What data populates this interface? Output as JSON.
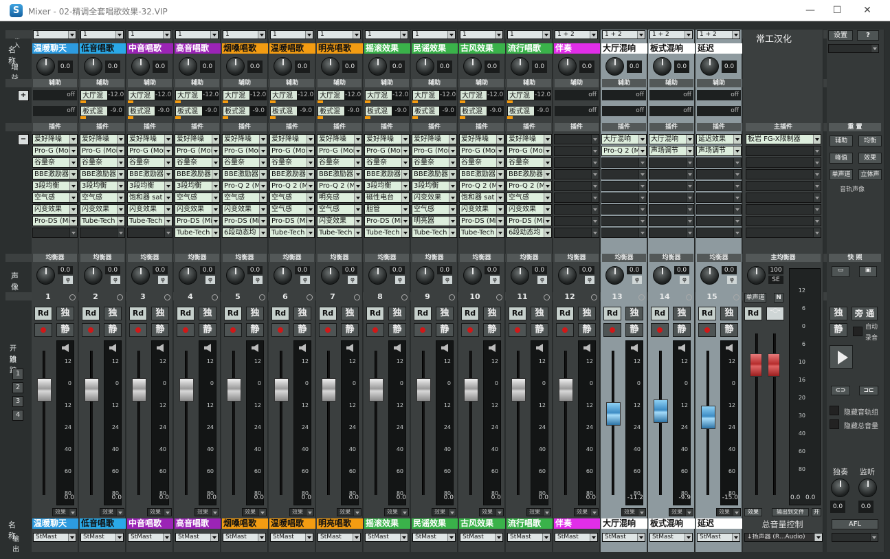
{
  "window": {
    "title": "Mixer - 02-精调全套唱歌效果-32.VIP",
    "minimize": "—",
    "maximize": "☐",
    "close": "✕"
  },
  "row_labels": {
    "input": "输入",
    "name": "名 称",
    "gain": "增益",
    "aux": "辅助",
    "plugin": "插件",
    "pan": "声像",
    "start": "开始",
    "follow": "跟踪",
    "name_bottom": "名 称",
    "output": "输出"
  },
  "numbered_buttons": [
    "1",
    "2",
    "3",
    "4"
  ],
  "channels": [
    {
      "num": "1",
      "input": "1",
      "name": "温暖聊天",
      "name_bg": "#2d9be0",
      "name_fg": "#ffffff",
      "gain": "0.0",
      "send1": "off",
      "send2": "off",
      "send1_label": "",
      "send2_label": "",
      "plugins": [
        "爱好降噪",
        "Pro-G (Moi",
        "谷量奈",
        "BBE激励器",
        "3段均衡",
        "空气感",
        "闪变效果",
        "Pro-DS (Mi",
        ""
      ],
      "pan": "0.0",
      "fader": 0.73,
      "vol": "0.0",
      "fx": "效果",
      "out": "StMast",
      "light": false
    },
    {
      "num": "2",
      "input": "1",
      "name": "低音唱歌",
      "name_bg": "#2aa9e8",
      "name_fg": "#111111",
      "gain": "0.0",
      "send1": "-12.0",
      "send2": "-9.0",
      "send1_label": "大厅混",
      "send2_label": "板式混",
      "plugins": [
        "爱好降噪",
        "Pro-G (Moi",
        "谷量奈",
        "BBE激励器",
        "3段均衡",
        "空气感",
        "闪变效果",
        "Tube-Tech",
        ""
      ],
      "pan": "0.0",
      "fader": 0.73,
      "vol": "0.0",
      "fx": "效果",
      "out": "StMast",
      "light": false
    },
    {
      "num": "3",
      "input": "1",
      "name": "中音唱歌",
      "name_bg": "#9b24b6",
      "name_fg": "#ffffff",
      "gain": "0.0",
      "send1": "-12.0",
      "send2": "-9.0",
      "send1_label": "大厅混",
      "send2_label": "板式混",
      "plugins": [
        "爱好降噪",
        "Pro-G (Moi",
        "谷量奈",
        "BBE激励器",
        "3段均衡",
        "饱和器 sat",
        "闪变效果",
        "Tube-Tech",
        ""
      ],
      "pan": "0.0",
      "fader": 0.73,
      "vol": "0.0",
      "fx": "效果",
      "out": "StMast",
      "light": false
    },
    {
      "num": "4",
      "input": "1",
      "name": "高音唱歌",
      "name_bg": "#9b24b6",
      "name_fg": "#ffffff",
      "gain": "0.0",
      "send1": "-12.0",
      "send2": "-9.0",
      "send1_label": "大厅混",
      "send2_label": "板式混",
      "plugins": [
        "爱好降噪",
        "Pro-G (Moi",
        "谷量奈",
        "BBE激励器",
        "3段均衡",
        "空气感",
        "闪变效果",
        "Pro-DS (Mi",
        "Tube-Tech"
      ],
      "pan": "0.0",
      "fader": 0.73,
      "vol": "0.0",
      "fx": "效果",
      "out": "StMast",
      "light": false
    },
    {
      "num": "5",
      "input": "1",
      "name": "烟嗓唱歌",
      "name_bg": "#f39c12",
      "name_fg": "#111111",
      "gain": "0.0",
      "send1": "-12.0",
      "send2": "-9.0",
      "send1_label": "大厅混",
      "send2_label": "板式混",
      "plugins": [
        "爱好降噪",
        "Pro-G (Moi",
        "谷量奈",
        "BBE激励器",
        "Pro-Q 2 (M",
        "空气感",
        "闪变效果",
        "Pro-DS (Mi",
        "6段动态均"
      ],
      "pan": "0.0",
      "fader": 0.73,
      "vol": "0.0",
      "fx": "效果",
      "out": "StMast",
      "light": false
    },
    {
      "num": "6",
      "input": "1",
      "name": "温暖唱歌",
      "name_bg": "#f39c12",
      "name_fg": "#111111",
      "gain": "0.0",
      "send1": "-12.0",
      "send2": "-9.0",
      "send1_label": "大厅混",
      "send2_label": "板式混",
      "plugins": [
        "爱好降噪",
        "Pro-G (Moi",
        "谷量奈",
        "BBE激励器",
        "Pro-Q 2 (M",
        "空气感",
        "空气感",
        "Pro-DS (Mi",
        "Tube-Tech"
      ],
      "pan": "0.0",
      "fader": 0.73,
      "vol": "0.0",
      "fx": "效果",
      "out": "StMast",
      "light": false
    },
    {
      "num": "7",
      "input": "1",
      "name": "明亮唱歌",
      "name_bg": "#f39c12",
      "name_fg": "#111111",
      "gain": "0.0",
      "send1": "-12.0",
      "send2": "-9.0",
      "send1_label": "大厅混",
      "send2_label": "板式混",
      "plugins": [
        "爱好降噪",
        "Pro-G (Moi",
        "谷量奈",
        "BBE激励器",
        "Pro-Q 2 (M",
        "明亮感",
        "空气感",
        "闪变效果",
        "Tube-Tech"
      ],
      "pan": "0.0",
      "fader": 0.73,
      "vol": "0.0",
      "fx": "效果",
      "out": "StMast",
      "light": false
    },
    {
      "num": "8",
      "input": "1",
      "name": "摇滚效果",
      "name_bg": "#3ab24a",
      "name_fg": "#ffffff",
      "gain": "0.0",
      "send1": "-12.0",
      "send2": "-9.0",
      "send1_label": "大厅混",
      "send2_label": "板式混",
      "plugins": [
        "爱好降噪",
        "Pro-G (Moi",
        "谷量奈",
        "BBE激励器",
        "3段均衡",
        "磁性电台",
        "胆管",
        "Pro-DS (Mi",
        "Tube-Tech"
      ],
      "pan": "0.0",
      "fader": 0.73,
      "vol": "0.0",
      "fx": "效果",
      "out": "StMast",
      "light": false
    },
    {
      "num": "9",
      "input": "1",
      "name": "民谣效果",
      "name_bg": "#3ab24a",
      "name_fg": "#ffffff",
      "gain": "0.0",
      "send1": "-12.0",
      "send2": "-9.0",
      "send1_label": "大厅混",
      "send2_label": "板式混",
      "plugins": [
        "爱好降噪",
        "Pro-G (Moi",
        "谷量奈",
        "BBE激励器",
        "3段均衡",
        "闪变效果",
        "空气感",
        "明亮器",
        "Tube-Tech"
      ],
      "pan": "0.0",
      "fader": 0.73,
      "vol": "0.0",
      "fx": "效果",
      "out": "StMast",
      "light": false
    },
    {
      "num": "10",
      "input": "1",
      "name": "古风效果",
      "name_bg": "#3ab24a",
      "name_fg": "#ffffff",
      "gain": "0.0",
      "send1": "-12.0",
      "send2": "-9.0",
      "send1_label": "大厅混",
      "send2_label": "板式混",
      "plugins": [
        "爱好降噪",
        "Pro-G (Moi",
        "谷量奈",
        "BBE激励器",
        "Pro-Q 2 (M",
        "饱和器 sat",
        "闪变效果",
        "Pro-DS (Mi",
        "Tube-Tech"
      ],
      "pan": "0.0",
      "fader": 0.73,
      "vol": "0.0",
      "fx": "效果",
      "out": "StMast",
      "light": false
    },
    {
      "num": "11",
      "input": "1",
      "name": "流行唱歌",
      "name_bg": "#3ab24a",
      "name_fg": "#ffffff",
      "gain": "0.0",
      "send1": "-12.0",
      "send2": "-9.0",
      "send1_label": "大厅混",
      "send2_label": "板式混",
      "plugins": [
        "爱好降噪",
        "Pro-G (Moi",
        "谷量奈",
        "BBE激励器",
        "Pro-Q 2 (M",
        "空气感",
        "闪变效果",
        "Pro-DS (Mi",
        "6段动态均"
      ],
      "pan": "0.0",
      "fader": 0.73,
      "vol": "0.0",
      "fx": "效果",
      "out": "StMast",
      "light": false
    },
    {
      "num": "12",
      "input": "1 + 2",
      "name": "伴奏",
      "name_bg": "#e12ee8",
      "name_fg": "#ffffff",
      "gain": "0.0",
      "send1": "off",
      "send2": "off",
      "send1_label": "",
      "send2_label": "",
      "plugins": [
        "",
        "",
        "",
        "",
        "",
        "",
        "",
        "",
        ""
      ],
      "pan": "0.0",
      "fader": 0.73,
      "vol": "0.0",
      "fx": "效果",
      "out": "StMast",
      "light": false
    },
    {
      "num": "13",
      "input": "1 + 2",
      "name": "大厅混响",
      "name_bg": "#ffffff",
      "name_fg": "#111111",
      "gain": "0.0",
      "send1": "off",
      "send2": "off",
      "send1_label": "",
      "send2_label": "",
      "plugins": [
        "大厅混响",
        "Pro-Q 2 (M",
        "",
        "",
        "",
        "",
        "",
        "",
        ""
      ],
      "pan": "0.0",
      "fader": 0.56,
      "vol": "-11.2",
      "fx": "效果",
      "out": "StMast",
      "light": true
    },
    {
      "num": "14",
      "input": "1 + 2",
      "name": "板式混响",
      "name_bg": "#ffffff",
      "name_fg": "#111111",
      "gain": "0.0",
      "send1": "off",
      "send2": "off",
      "send1_label": "",
      "send2_label": "",
      "plugins": [
        "大厅混响",
        "声场调节",
        "",
        "",
        "",
        "",
        "",
        "",
        ""
      ],
      "pan": "0.0",
      "fader": 0.58,
      "vol": "-9.9",
      "fx": "效果",
      "out": "StMast",
      "light": true
    },
    {
      "num": "15",
      "input": "1 + 2",
      "name": "延迟",
      "name_bg": "#ffffff",
      "name_fg": "#111111",
      "gain": "0.0",
      "send1": "off",
      "send2": "off",
      "send1_label": "",
      "send2_label": "",
      "plugins": [
        "延迟效果",
        "声场调节",
        "",
        "",
        "",
        "",
        "",
        "",
        ""
      ],
      "pan": "0.0",
      "fader": 0.54,
      "vol": "-15.0",
      "fx": "效果",
      "out": "StMast",
      "light": true
    }
  ],
  "channel_buttons": {
    "rd": "Rd",
    "solo": "独",
    "mute": "静"
  },
  "headers": {
    "eq": "均衡器",
    "aux": "辅助",
    "plugin": "插件"
  },
  "scale": [
    "12",
    "0",
    "12",
    "24",
    "40",
    "60",
    "80"
  ],
  "master": {
    "title": "常工汉化",
    "plugin_header": "主插件",
    "plugins": [
      "板岩 FG-X限制器",
      "",
      "",
      "",
      "",
      "",
      "",
      "",
      ""
    ],
    "eq_header": "主均衡器",
    "pan": "100",
    "pan_unit": "SE",
    "mono": "单声道",
    "n_btn": "N",
    "rd": "Rd",
    "fx": "效果",
    "export": "输出到文件",
    "open": "开",
    "name": "总音量控制",
    "out": "↓扬声器 (R...Audio)",
    "fader": 0.78
  },
  "right_panel": {
    "settings": "设置",
    "help": "?",
    "reset": "重 置",
    "aux": "辅助",
    "eq": "均衡",
    "peak": "峰值",
    "fx": "效果",
    "mono": "单声道",
    "stereo": "立体声",
    "track_pan": "音轨声像",
    "snapshot": "快 照",
    "solo": "独",
    "bypass": "旁 通",
    "mute": "静",
    "auto": "自动",
    "record": "录音",
    "hide_group": "隐藏音轨组",
    "hide_master": "隐藏总音量",
    "solo_lbl": "独奏",
    "monitor_lbl": "监听",
    "solo_val": "0.0",
    "monitor_val": "0.0",
    "afl": "AFL",
    "master_scale": [
      "12",
      "6",
      "0",
      "6",
      "10",
      "16",
      "20",
      "30",
      "40",
      "60",
      "80"
    ],
    "master_vals": [
      "0.0",
      "0.0"
    ]
  }
}
